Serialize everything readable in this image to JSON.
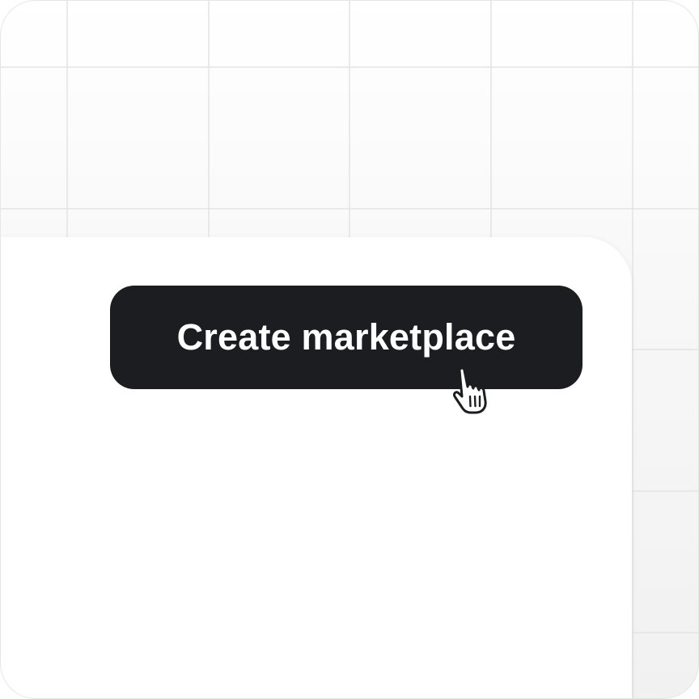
{
  "action_button": {
    "label": "Create marketplace"
  },
  "cursor": {
    "icon": "hand-pointer-icon"
  },
  "colors": {
    "button_background": "#1b1d20",
    "button_text": "#ffffff",
    "grid_line": "#e2e2e2",
    "panel_background": "#ffffff"
  }
}
